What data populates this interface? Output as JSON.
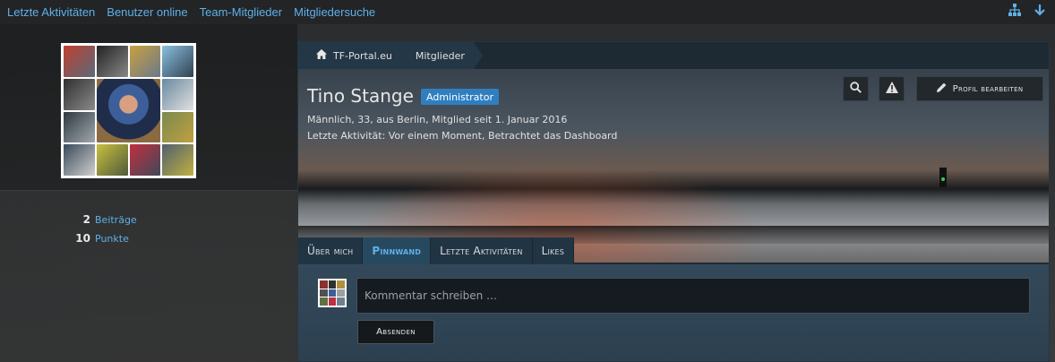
{
  "topnav": {
    "links": [
      "Letzte Aktivitäten",
      "Benutzer online",
      "Team-Mitglieder",
      "Mitgliedersuche"
    ],
    "icons": [
      "sitemap-icon",
      "arrow-down-icon"
    ]
  },
  "sidebar": {
    "stats": [
      {
        "value": "2",
        "label": "Beiträge"
      },
      {
        "value": "10",
        "label": "Punkte"
      }
    ]
  },
  "breadcrumb": {
    "items": [
      "TF-Portal.eu",
      "Mitglieder"
    ]
  },
  "profile": {
    "name": "Tino Stange",
    "badge": "Administrator",
    "meta": "Männlich, 33, aus Berlin, Mitglied seit 1. Januar 2016",
    "activity": "Letzte Aktivität: Vor einem Moment, Betrachtet das Dashboard",
    "edit_label": "Profil bearbeiten"
  },
  "tabs": [
    {
      "label": "Über mich",
      "active": false
    },
    {
      "label": "Pinnwand",
      "active": true
    },
    {
      "label": "Letzte Aktivitäten",
      "active": false
    },
    {
      "label": "Likes",
      "active": false
    }
  ],
  "wall": {
    "placeholder": "Kommentar schreiben …",
    "submit_label": "Absenden"
  },
  "colors": {
    "link": "#5fb0e8",
    "badge": "#2f7fc0",
    "panel": "#1d2a34"
  }
}
